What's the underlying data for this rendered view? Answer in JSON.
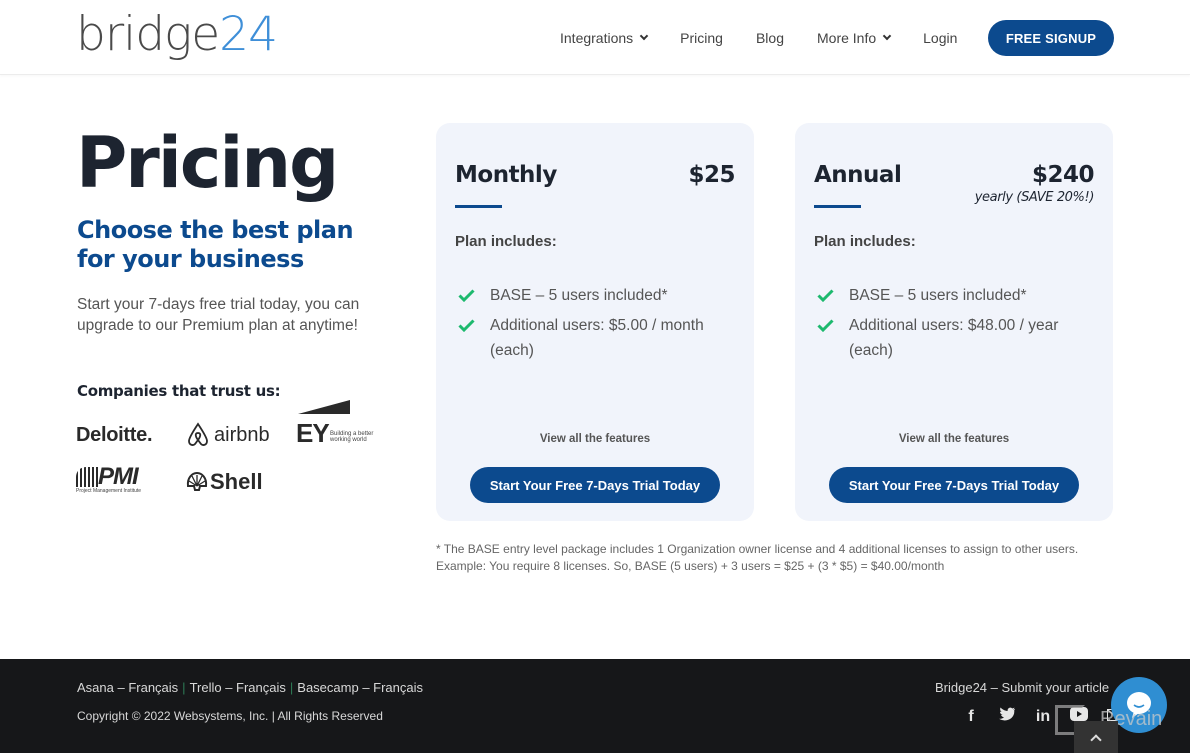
{
  "header": {
    "logo_text": "bridge",
    "logo_num": "24",
    "nav": [
      {
        "label": "Integrations",
        "has_dropdown": true
      },
      {
        "label": "Pricing",
        "has_dropdown": false
      },
      {
        "label": "Blog",
        "has_dropdown": false
      },
      {
        "label": "More Info",
        "has_dropdown": true
      },
      {
        "label": "Login",
        "has_dropdown": false
      }
    ],
    "signup_label": "FREE SIGNUP"
  },
  "hero": {
    "title": "Pricing",
    "subtitle": "Choose the best plan for your business",
    "description": "Start your 7-days free trial today, you can upgrade to our Premium plan at anytime!",
    "trust_title": "Companies that trust us:",
    "companies": [
      "Deloitte.",
      "airbnb",
      "EY",
      "PMI",
      "Shell"
    ],
    "ey_tagline": "Building a better working world",
    "pmi_tagline": "Project Management Institute"
  },
  "plans": [
    {
      "name": "Monthly",
      "price": "$25",
      "price_note": "",
      "includes_label": "Plan includes:",
      "features": [
        "BASE – 5 users included*",
        "Additional users: $5.00 / month (each)"
      ],
      "view_features": "View all the features",
      "cta": "Start Your Free 7-Days Trial Today"
    },
    {
      "name": "Annual",
      "price": "$240",
      "price_note": "yearly (SAVE 20%!)",
      "includes_label": "Plan includes:",
      "features": [
        "BASE – 5 users included*",
        "Additional users: $48.00 / year (each)"
      ],
      "view_features": "View all the features",
      "cta": "Start Your Free 7-Days Trial Today"
    }
  ],
  "footnote": {
    "line1": "* The BASE entry level package includes 1 Organization owner license and 4 additional licenses to assign to other users.",
    "line2": "Example: You require 8 licenses. So, BASE (5 users) + 3 users = $25 + (3 * $5) = $40.00/month"
  },
  "footer": {
    "links": [
      "Asana – Français",
      "Trello – Français",
      "Basecamp – Français"
    ],
    "separator": "|",
    "copyright": "Copyright © 2022 Websystems, Inc. | All Rights Reserved",
    "submit": "Bridge24 – Submit your article",
    "social": [
      "facebook",
      "twitter",
      "linkedin",
      "youtube",
      "email"
    ],
    "watermark": "Revain"
  },
  "colors": {
    "brand_blue": "#0c4a8e",
    "logo_accent": "#3f8fd8",
    "check_green": "#1db96e",
    "card_bg": "#f1f4fb",
    "footer_bg": "#161719"
  }
}
